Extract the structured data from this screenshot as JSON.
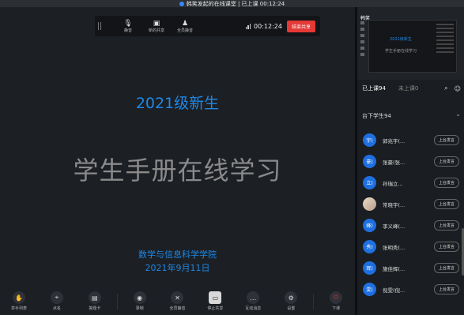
{
  "window": {
    "title": "韩笑发起的在线课堂 | 已上课 00:12:24"
  },
  "toolbar": {
    "buttons": [
      {
        "label": "静音",
        "icon": "mic-icon"
      },
      {
        "label": "新的共享",
        "icon": "share-screen-icon"
      },
      {
        "label": "全员静音",
        "icon": "mute-all-icon"
      }
    ],
    "timer": "00:12:24",
    "end_share": "结束共享"
  },
  "slide": {
    "title1": "2021级新生",
    "title2": "学生手册在线学习",
    "org": "数学与信息科学学院",
    "date": "2021年9月11日"
  },
  "bottom_bar": {
    "items": [
      {
        "label": "举手列表",
        "glyph": "✋"
      },
      {
        "label": "点名",
        "glyph": "⌖"
      },
      {
        "label": "答题卡",
        "glyph": "▤"
      },
      {
        "label": "录制",
        "glyph": "◉"
      },
      {
        "label": "全员静音",
        "glyph": "✕"
      },
      {
        "label": "停止共享",
        "glyph": "▭"
      },
      {
        "label": "互动消息",
        "glyph": "…"
      },
      {
        "label": "设置",
        "glyph": "⚙"
      },
      {
        "label": "下课",
        "glyph": "⏻"
      }
    ]
  },
  "panel": {
    "preview": {
      "name": "韩笑",
      "title1": "2021级新生",
      "title2": "学生手册在线学习"
    },
    "tabs": {
      "active": "已上课94",
      "inactive": "未上课0"
    },
    "section_title": "台下学生94",
    "students": [
      {
        "avatar": "宇)",
        "name": "郭兆宇(...",
        "action": "上台发言"
      },
      {
        "avatar": "豪)",
        "name": "张豪(张...",
        "action": "上台发言"
      },
      {
        "avatar": "立)",
        "name": "孙瑞立...",
        "action": "上台发言"
      },
      {
        "avatar": "",
        "name": "常晓宇(...",
        "action": "上台发言"
      },
      {
        "avatar": "峰)",
        "name": "李义峰(...",
        "action": "上台发言"
      },
      {
        "avatar": "秀)",
        "name": "张明秀(...",
        "action": "上台发言"
      },
      {
        "avatar": "辉)",
        "name": "施佳辉(...",
        "action": "上台发言"
      },
      {
        "avatar": "雯)",
        "name": "倪雯(倪...",
        "action": "上台发言"
      }
    ]
  }
}
